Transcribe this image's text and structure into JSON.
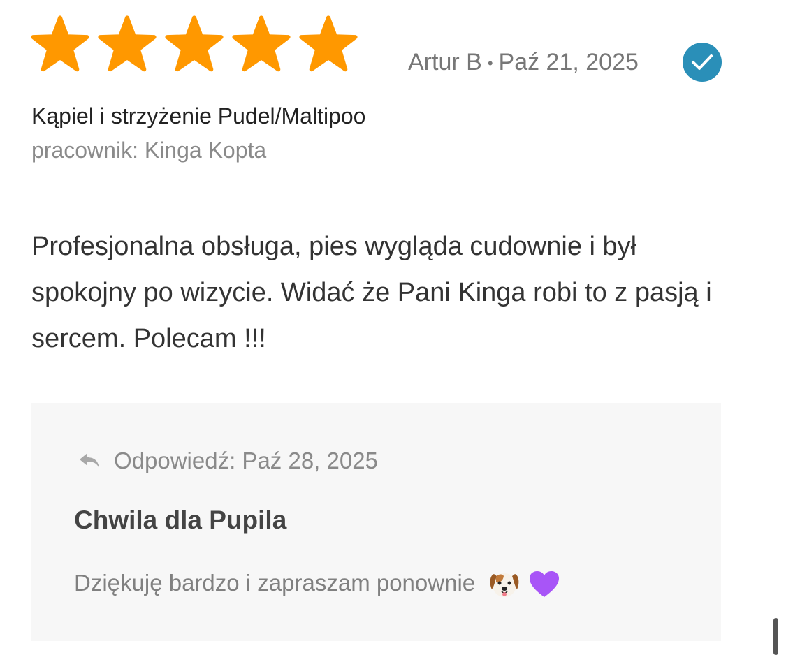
{
  "review": {
    "rating": 5,
    "rating_max": 5,
    "star_color": "#FF9800",
    "author": "Artur B",
    "separator": "•",
    "date": "Paź 21, 2025",
    "verified_icon": "check-circle-icon",
    "verified_color": "#2A8FB8",
    "service": "Kąpiel i strzyżenie Pudel/Maltipoo",
    "staff": "pracownik: Kinga Kopta",
    "text": "Profesjonalna obsługa, pies wygląda cudownie i był spokojny po wizycie. Widać że Pani Kinga robi to z pasją i sercem. Polecam !!!"
  },
  "reply": {
    "icon": "reply-arrow-icon",
    "header": "Odpowiedź: Paź 28, 2025",
    "business_name": "Chwila dla Pupila",
    "text": "Dziękuję bardzo i zapraszam ponownie",
    "emoji_dog": "dog-face-emoji",
    "emoji_heart": "purple-heart-emoji",
    "background": "#F7F7F7"
  }
}
